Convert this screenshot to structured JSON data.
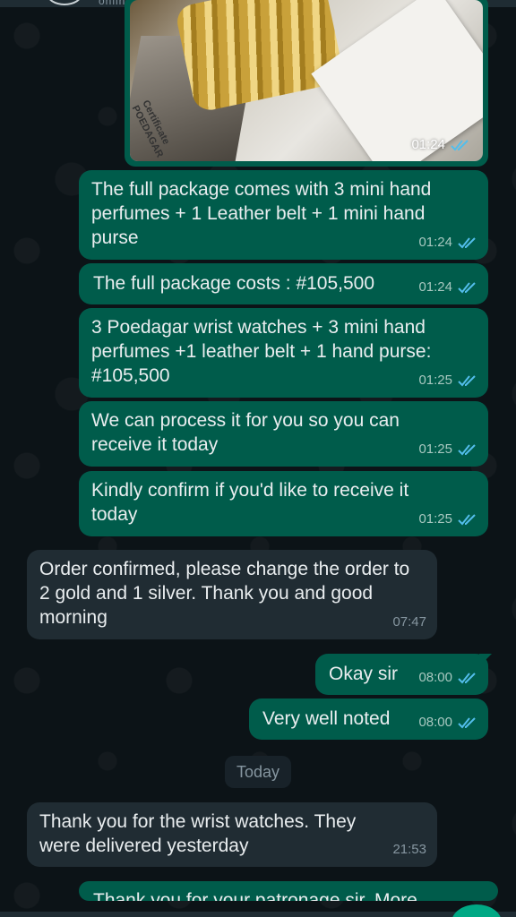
{
  "header": {
    "status": "online"
  },
  "image_message": {
    "certificate_text": [
      "POEDAGAR",
      "Certificate"
    ],
    "time": "01:24"
  },
  "messages": [
    {
      "dir": "out",
      "text": "The full package comes with 3 mini hand perfumes + 1 Leather belt + 1 mini hand purse",
      "time": "01:24"
    },
    {
      "dir": "out",
      "text": "The full package costs : #105,500",
      "time": "01:24"
    },
    {
      "dir": "out",
      "text": "3 Poedagar wrist watches + 3 mini hand perfumes +1 leather belt + 1 hand purse: #105,500",
      "time": "01:25"
    },
    {
      "dir": "out",
      "text": "We can process it for you so you can receive it today",
      "time": "01:25"
    },
    {
      "dir": "out",
      "text": "Kindly confirm if you'd like to receive it today",
      "time": "01:25"
    },
    {
      "dir": "in",
      "text": "Order confirmed, please change the order to 2 gold and 1 silver. Thank you and good morning",
      "time": "07:47"
    },
    {
      "dir": "out",
      "text": "Okay sir",
      "time": "08:00"
    },
    {
      "dir": "out",
      "text": "Very well noted",
      "time": "08:00"
    },
    {
      "dir": "in",
      "text": "Thank you for the wrist watches. They were delivered yesterday",
      "time": "21:53"
    },
    {
      "dir": "out",
      "text": "Thank you for your patronage sir. More",
      "time": ""
    }
  ],
  "date_divider": "Today",
  "colors": {
    "outgoing": "#005c4b",
    "incoming": "#202c33",
    "read_ticks": "#53bdeb"
  }
}
